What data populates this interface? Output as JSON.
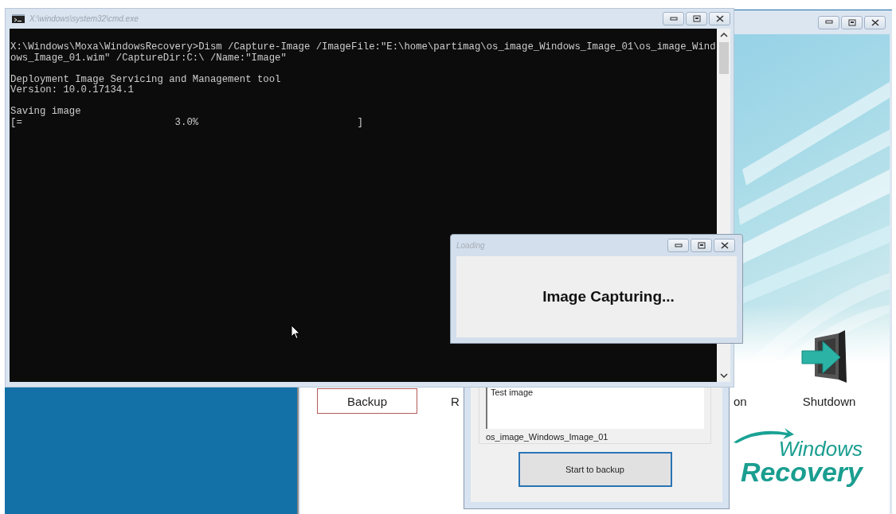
{
  "main_window": {
    "items": [
      {
        "label": "Backup",
        "selected": true
      },
      {
        "label": "R",
        "selected": false
      },
      {
        "label": "on",
        "selected": false
      },
      {
        "label": "Shutdown",
        "selected": false
      }
    ],
    "logo": {
      "line_1": "Windows",
      "line_2": "Recovery"
    }
  },
  "backup_dialog": {
    "description": "Test image",
    "image_name": "os_image_Windows_Image_01",
    "button": "Start to backup"
  },
  "console": {
    "title": "X:\\windows\\system32\\cmd.exe",
    "blocks": [
      [
        "X:\\Windows\\Moxa\\WindowsRecovery>Dism /Capture-Image /ImageFile:\"E:\\home\\partimag\\os_image_Windows_Image_01\\os_image_Wind",
        "ows_Image_01.wim\" /CaptureDir:C:\\ /Name:\"Image\""
      ],
      [
        "Deployment Image Servicing and Management tool",
        "Version: 10.0.17134.1"
      ],
      [
        "Saving image",
        "[=                          3.0%                           ]"
      ]
    ]
  },
  "loading_dialog": {
    "title": "Loading",
    "message": "Image Capturing..."
  }
}
